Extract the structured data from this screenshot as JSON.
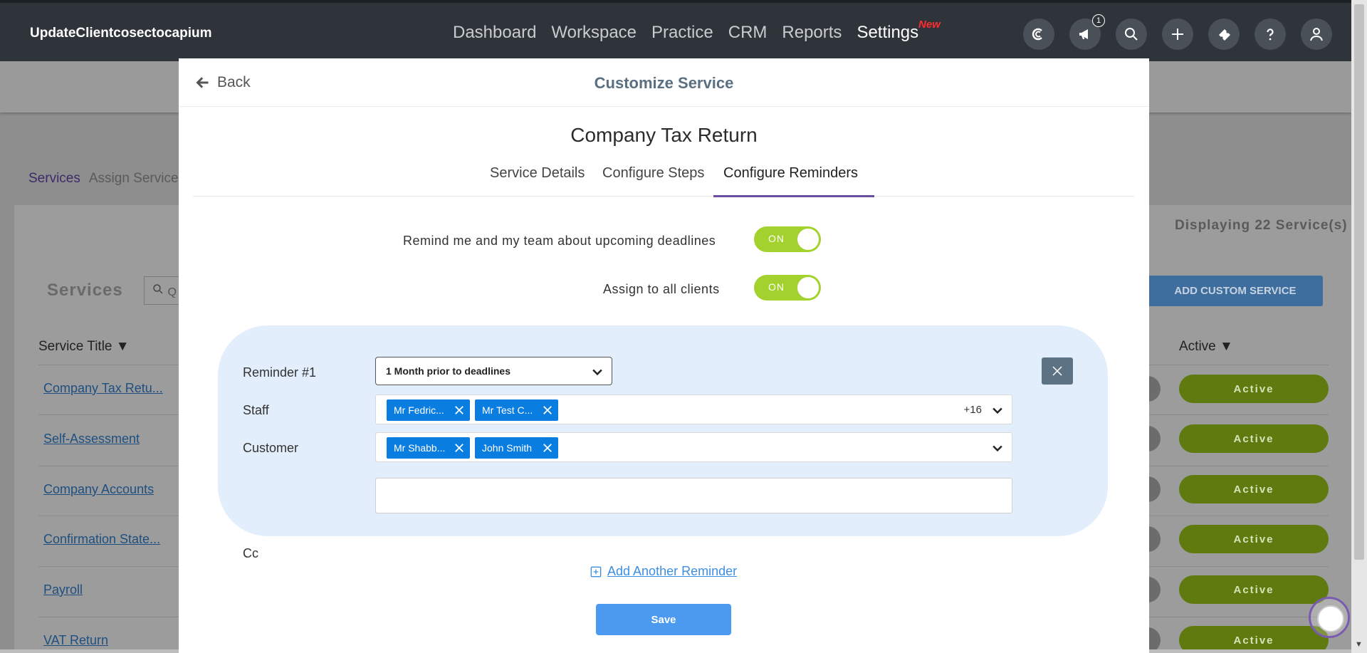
{
  "topnav": {
    "brand": "UpdateClientcosectocapium",
    "links": [
      "Dashboard",
      "Workspace",
      "Practice",
      "CRM",
      "Reports",
      "Settings"
    ],
    "new_tag": "New",
    "notification_count": "1",
    "icons": [
      "capium-logo-icon",
      "megaphone-icon",
      "search-icon",
      "plus-icon",
      "ticket-icon",
      "help-icon",
      "user-icon"
    ]
  },
  "background": {
    "tabs": [
      "Services",
      "Assign Services"
    ],
    "displaying": "Displaying 22 Service(s)",
    "services_heading": "Services",
    "search_placeholder": "Q",
    "add_button": "ADD CUSTOM SERVICE",
    "col_title": "Service Title ▼",
    "col_active": "Active ▼",
    "rows": [
      {
        "title": "Company Tax Retu...",
        "status": "Active"
      },
      {
        "title": "Self-Assessment",
        "status": "Active"
      },
      {
        "title": "Company Accounts",
        "status": "Active"
      },
      {
        "title": "Confirmation State...",
        "status": "Active"
      },
      {
        "title": "Payroll",
        "status": "Active"
      },
      {
        "title": "VAT Return",
        "status": "Active"
      }
    ]
  },
  "modal": {
    "back_label": "Back",
    "title": "Customize Service",
    "service_name": "Company Tax Return",
    "tabs": [
      "Service Details",
      "Configure Steps",
      "Configure Reminders"
    ],
    "active_tab": "Configure Reminders",
    "toggles": [
      {
        "label": "Remind me and my team about upcoming deadlines",
        "state": "ON"
      },
      {
        "label": "Assign to all clients",
        "state": "ON"
      }
    ],
    "reminder": {
      "label": "Reminder #1",
      "timing": "1 Month prior to deadlines",
      "staff_label": "Staff",
      "staff": [
        "Mr Fedric...",
        "Mr Test C..."
      ],
      "staff_more": "+16",
      "customer_label": "Customer",
      "customers": [
        "Mr Shabb...",
        "John Smith"
      ],
      "cc_label": "Cc",
      "cc_value": ""
    },
    "add_reminder": "Add Another Reminder",
    "save": "Save"
  },
  "colors": {
    "nav_bg": "#2f343b",
    "toggle_on": "#a3d22e",
    "chip": "#0a7de0",
    "primary": "#4b9af0",
    "tab_underline": "#6a4fa3",
    "card_bg": "#e2eefb"
  }
}
